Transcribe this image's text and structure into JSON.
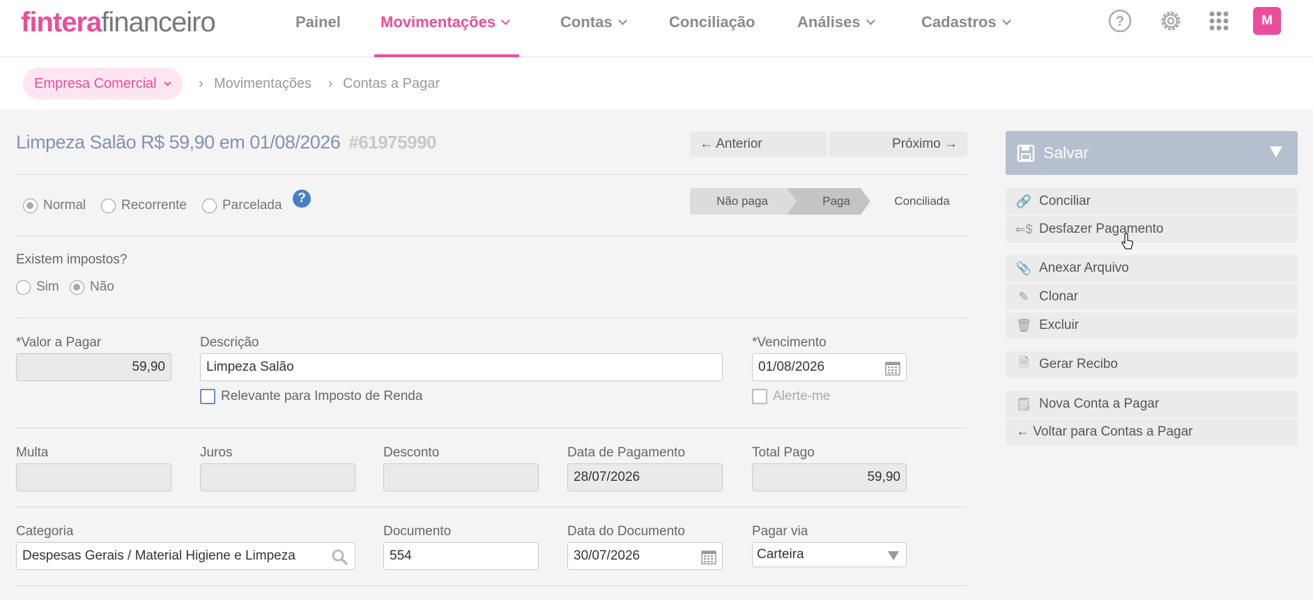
{
  "logo": {
    "brand": "fintera",
    "sub": "financeiro"
  },
  "nav": {
    "painel": "Painel",
    "movimentacoes": "Movimentações",
    "contas": "Contas",
    "conciliacao": "Conciliação",
    "analises": "Análises",
    "cadastros": "Cadastros"
  },
  "user": {
    "avatar": "M"
  },
  "breadcrumb": {
    "company": "Empresa Comercial",
    "items": [
      "Movimentações",
      "Contas a Pagar"
    ]
  },
  "record": {
    "title": "Limpeza Salão R$ 59,90 em 01/08/2026",
    "id": "#61975990"
  },
  "pager": {
    "prev": "← Anterior",
    "next": "Próximo →"
  },
  "type_options": [
    {
      "label": "Normal",
      "checked": true
    },
    {
      "label": "Recorrente",
      "checked": false
    },
    {
      "label": "Parcelada",
      "checked": false
    }
  ],
  "status_steps": [
    "Não paga",
    "Paga",
    "Conciliada"
  ],
  "status_current": "Paga",
  "taxes": {
    "question": "Existem impostos?",
    "yes": "Sim",
    "no": "Não",
    "selected": "Não"
  },
  "fields": {
    "valor": {
      "label": "*Valor a Pagar",
      "value": "59,90"
    },
    "descricao": {
      "label": "Descrição",
      "value": "Limpeza Salão"
    },
    "ir": {
      "label": "Relevante para Imposto de Renda"
    },
    "vencimento": {
      "label": "*Vencimento",
      "value": "01/08/2026"
    },
    "alerte": {
      "label": "Alerte-me"
    },
    "multa": {
      "label": "Multa",
      "value": ""
    },
    "juros": {
      "label": "Juros",
      "value": ""
    },
    "desconto": {
      "label": "Desconto",
      "value": ""
    },
    "data_pagamento": {
      "label": "Data de Pagamento",
      "value": "28/07/2026"
    },
    "total_pago": {
      "label": "Total Pago",
      "value": "59,90"
    },
    "categoria": {
      "label": "Categoria",
      "value": "Despesas Gerais / Material Higiene e Limpeza"
    },
    "documento": {
      "label": "Documento",
      "value": "554"
    },
    "data_documento": {
      "label": "Data do Documento",
      "value": "30/07/2026"
    },
    "pagar_via": {
      "label": "Pagar via",
      "value": "Carteira"
    }
  },
  "actions": {
    "save": "Salvar",
    "conciliar": "Conciliar",
    "desfazer": "Desfazer Pagamento",
    "anexar": "Anexar Arquivo",
    "clonar": "Clonar",
    "excluir": "Excluir",
    "recibo": "Gerar Recibo",
    "nova": "Nova Conta a Pagar",
    "voltar": "← Voltar para Contas a Pagar"
  },
  "colors": {
    "accent": "#ec4d9b",
    "title": "#8591ae",
    "save_bg": "#b5bfcf"
  }
}
